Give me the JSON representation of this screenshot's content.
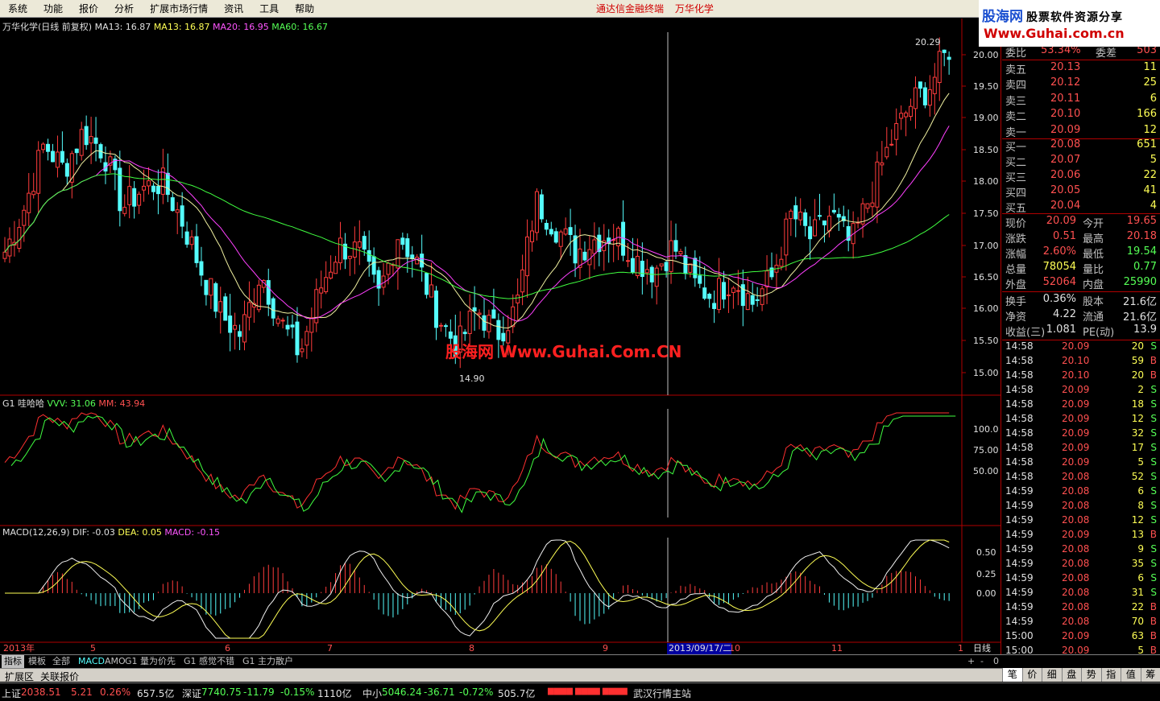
{
  "menu": [
    "系统",
    "功能",
    "报价",
    "分析",
    "扩展市场行情",
    "资讯",
    "工具",
    "帮助"
  ],
  "window_title": [
    "通达信金融终端",
    "万华化学"
  ],
  "logo": {
    "brand": "股海网",
    "tagline": "股票软件资源分享",
    "url": "Www.Guhai.com.cn"
  },
  "watermark": "股海网 Www.Guhai.Com.CN",
  "main_header": {
    "stock": "万华化学(日线 前复权)",
    "ma13a": "MA13: 16.87",
    "ma13b": "MA13: 16.87",
    "ma20": "MA20: 16.95",
    "ma60": "MA60: 16.67"
  },
  "price_axis": [
    "20.00",
    "19.50",
    "19.00",
    "18.50",
    "18.00",
    "17.50",
    "17.00",
    "16.50",
    "16.00",
    "15.50",
    "15.00"
  ],
  "high_label": "20.29",
  "low_label": "14.90",
  "ind1_header": {
    "name": "G1 哇哈哈",
    "vvv": "VVV: 31.06",
    "mm": "MM: 43.94"
  },
  "ind1_axis": [
    "100.0",
    "75.00",
    "50.00"
  ],
  "macd_header": {
    "name": "MACD(12,26,9)",
    "dif": "DIF: -0.03",
    "dea": "DEA: 0.05",
    "macd": "MACD: -0.15"
  },
  "macd_axis": [
    "0.50",
    "0.25",
    "0.00"
  ],
  "date_axis": [
    "2013年",
    "5",
    "6",
    "7",
    "8",
    "9",
    "10",
    "11",
    "1"
  ],
  "date_cursor": "2013/09/17/二",
  "period": "日线",
  "order_book": {
    "wei_bi_label": "委比",
    "wei_bi": "53.34%",
    "wei_cha_label": "委差",
    "wei_cha": "503",
    "sell": [
      {
        "label": "卖五",
        "price": "20.13",
        "vol": "11"
      },
      {
        "label": "卖四",
        "price": "20.12",
        "vol": "25"
      },
      {
        "label": "卖三",
        "price": "20.11",
        "vol": "6"
      },
      {
        "label": "卖二",
        "price": "20.10",
        "vol": "166"
      },
      {
        "label": "卖一",
        "price": "20.09",
        "vol": "12"
      }
    ],
    "buy": [
      {
        "label": "买一",
        "price": "20.08",
        "vol": "651"
      },
      {
        "label": "买二",
        "price": "20.07",
        "vol": "5"
      },
      {
        "label": "买三",
        "price": "20.06",
        "vol": "22"
      },
      {
        "label": "买四",
        "price": "20.05",
        "vol": "41"
      },
      {
        "label": "买五",
        "price": "20.04",
        "vol": "4"
      }
    ]
  },
  "quote": [
    {
      "l1": "现价",
      "v1": "20.09",
      "c1": "#ff5050",
      "l2": "今开",
      "v2": "19.65",
      "c2": "#ff5050"
    },
    {
      "l1": "涨跌",
      "v1": "0.51",
      "c1": "#ff5050",
      "l2": "最高",
      "v2": "20.18",
      "c2": "#ff5050"
    },
    {
      "l1": "涨幅",
      "v1": "2.60%",
      "c1": "#ff5050",
      "l2": "最低",
      "v2": "19.54",
      "c2": "#55ff55"
    },
    {
      "l1": "总量",
      "v1": "78054",
      "c1": "#ffff55",
      "l2": "量比",
      "v2": "0.77",
      "c2": "#55ff55"
    },
    {
      "l1": "外盘",
      "v1": "52064",
      "c1": "#ff5050",
      "l2": "内盘",
      "v2": "25990",
      "c2": "#55ff55"
    }
  ],
  "fundamentals": [
    {
      "l1": "换手",
      "v1": "0.36%",
      "l2": "股本",
      "v2": "21.6亿"
    },
    {
      "l1": "净资",
      "v1": "4.22",
      "l2": "流通",
      "v2": "21.6亿"
    },
    {
      "l1": "收益(三)",
      "v1": "1.081",
      "l2": "PE(动)",
      "v2": "13.9"
    }
  ],
  "ticks": [
    {
      "t": "14:58",
      "p": "20.09",
      "v": "20",
      "s": "S"
    },
    {
      "t": "14:58",
      "p": "20.10",
      "v": "59",
      "s": "B"
    },
    {
      "t": "14:58",
      "p": "20.10",
      "v": "20",
      "s": "B"
    },
    {
      "t": "14:58",
      "p": "20.09",
      "v": "2",
      "s": "S"
    },
    {
      "t": "14:58",
      "p": "20.09",
      "v": "18",
      "s": "S"
    },
    {
      "t": "14:58",
      "p": "20.09",
      "v": "12",
      "s": "S"
    },
    {
      "t": "14:58",
      "p": "20.09",
      "v": "32",
      "s": "S"
    },
    {
      "t": "14:58",
      "p": "20.09",
      "v": "17",
      "s": "S"
    },
    {
      "t": "14:58",
      "p": "20.09",
      "v": "5",
      "s": "S"
    },
    {
      "t": "14:58",
      "p": "20.08",
      "v": "52",
      "s": "S"
    },
    {
      "t": "14:59",
      "p": "20.08",
      "v": "6",
      "s": "S"
    },
    {
      "t": "14:59",
      "p": "20.08",
      "v": "8",
      "s": "S"
    },
    {
      "t": "14:59",
      "p": "20.08",
      "v": "12",
      "s": "S"
    },
    {
      "t": "14:59",
      "p": "20.09",
      "v": "13",
      "s": "B"
    },
    {
      "t": "14:59",
      "p": "20.08",
      "v": "9",
      "s": "S"
    },
    {
      "t": "14:59",
      "p": "20.08",
      "v": "35",
      "s": "S"
    },
    {
      "t": "14:59",
      "p": "20.08",
      "v": "6",
      "s": "S"
    },
    {
      "t": "14:59",
      "p": "20.08",
      "v": "31",
      "s": "S"
    },
    {
      "t": "14:59",
      "p": "20.08",
      "v": "22",
      "s": "B"
    },
    {
      "t": "14:59",
      "p": "20.08",
      "v": "70",
      "B": "",
      "s": "B"
    },
    {
      "t": "15:00",
      "p": "20.09",
      "v": "63",
      "s": "B"
    },
    {
      "t": "15:00",
      "p": "20.09",
      "v": "5",
      "s": "B"
    }
  ],
  "bottom_tabs": [
    "指标",
    "模板",
    "全部",
    "MACD",
    "AMO",
    "G1 量为价先",
    "G1 感觉不错",
    "G1 主力散户"
  ],
  "ext_tabs": [
    "扩展区",
    "关联报价"
  ],
  "right_tabs": [
    "笔",
    "价",
    "细",
    "盘",
    "势",
    "指",
    "值",
    "筹"
  ],
  "status": {
    "sh_label": "上证",
    "sh": "2038.51",
    "sh_chg": "5.21",
    "sh_pct": "0.26%",
    "sh_amt": "657.5亿",
    "sz_label": "深证",
    "sz": "7740.75",
    "sz_chg": "-11.79",
    "sz_pct": "-0.15%",
    "sz_amt": "1110亿",
    "zx_label": "中小",
    "zx": "5046.24",
    "zx_chg": "-36.71",
    "zx_pct": "-0.72%",
    "zx_amt": "505.7亿",
    "station": "武汉行情主站"
  },
  "colors": {
    "up": "#ff3c3c",
    "down": "#54fcfc",
    "ma13": "#f0f0a0",
    "ma20": "#ff40ff",
    "ma60": "#40ff40"
  }
}
